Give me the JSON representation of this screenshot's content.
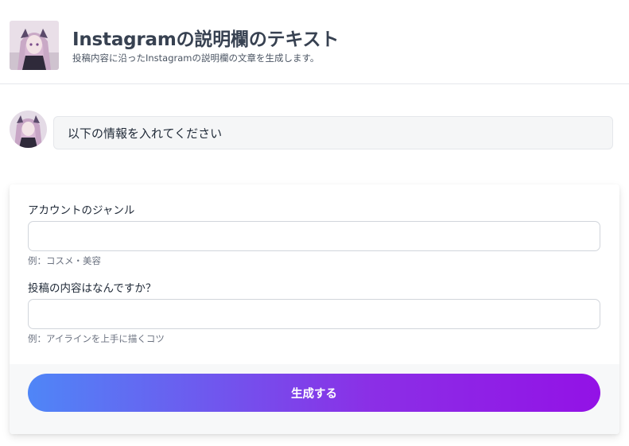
{
  "header": {
    "title": "Instagramの説明欄のテキスト",
    "subtitle": "投稿内容に沿ったInstagramの説明欄の文章を生成します。"
  },
  "chat": {
    "message": "以下の情報を入れてください"
  },
  "form": {
    "fields": [
      {
        "label": "アカウントのジャンル",
        "value": "",
        "placeholder": "",
        "hint": "例：コスメ・美容"
      },
      {
        "label": "投稿の内容はなんですか？",
        "value": "",
        "placeholder": "",
        "hint": "例：アイラインを上手に描くコツ"
      }
    ],
    "submit_label": "生成する"
  },
  "colors": {
    "button_gradient_start": "#4f86f7",
    "button_gradient_end": "#9312e6",
    "title": "#374151"
  }
}
